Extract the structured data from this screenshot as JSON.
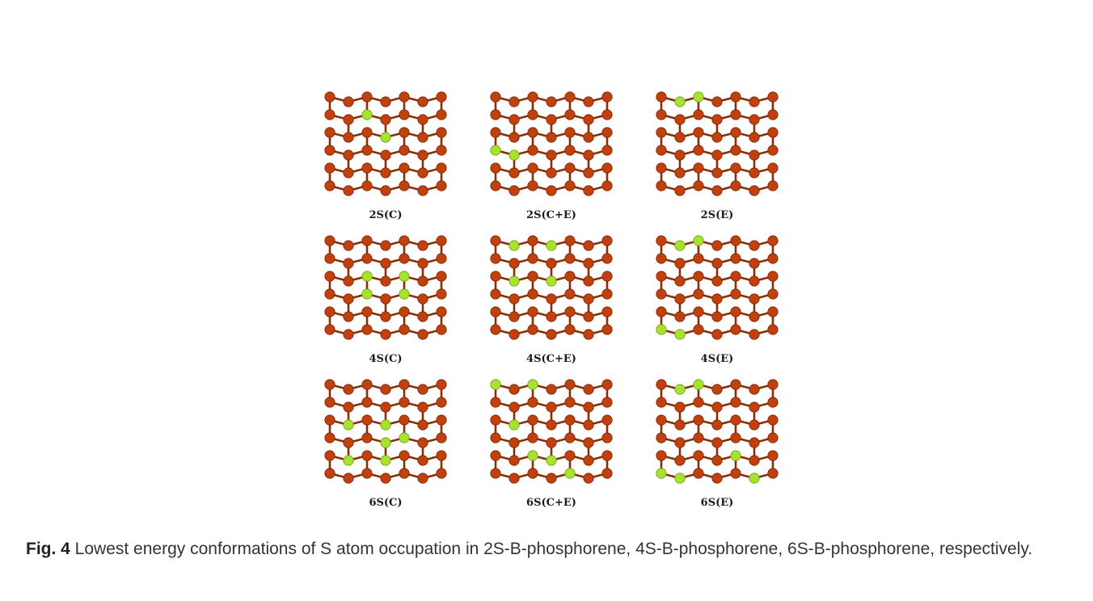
{
  "figure": {
    "panels": [
      {
        "label": "2S(C)",
        "s_sites": [
          [
            1,
            2
          ],
          [
            2,
            3
          ]
        ]
      },
      {
        "label": "2S(C+E)",
        "s_sites": [
          [
            3,
            0
          ],
          [
            3,
            1
          ]
        ]
      },
      {
        "label": "2S(E)",
        "s_sites": [
          [
            0,
            1
          ],
          [
            0,
            2
          ]
        ]
      },
      {
        "label": "4S(C)",
        "s_sites": [
          [
            2,
            2
          ],
          [
            2,
            4
          ],
          [
            3,
            2
          ],
          [
            3,
            4
          ]
        ]
      },
      {
        "label": "4S(C+E)",
        "s_sites": [
          [
            0,
            1
          ],
          [
            0,
            3
          ],
          [
            2,
            1
          ],
          [
            2,
            3
          ]
        ]
      },
      {
        "label": "4S(E)",
        "s_sites": [
          [
            0,
            1
          ],
          [
            0,
            2
          ],
          [
            5,
            0
          ],
          [
            5,
            1
          ]
        ]
      },
      {
        "label": "6S(C)",
        "s_sites": [
          [
            2,
            1
          ],
          [
            2,
            3
          ],
          [
            3,
            3
          ],
          [
            3,
            4
          ],
          [
            4,
            1
          ],
          [
            4,
            3
          ]
        ]
      },
      {
        "label": "6S(C+E)",
        "s_sites": [
          [
            0,
            0
          ],
          [
            0,
            2
          ],
          [
            2,
            1
          ],
          [
            4,
            2
          ],
          [
            4,
            3
          ],
          [
            5,
            4
          ]
        ]
      },
      {
        "label": "6S(E)",
        "s_sites": [
          [
            0,
            1
          ],
          [
            0,
            2
          ],
          [
            5,
            0
          ],
          [
            5,
            1
          ],
          [
            4,
            4
          ],
          [
            5,
            5
          ]
        ]
      }
    ],
    "colors": {
      "phosphorus": "#c0400e",
      "sulfur": "#a6e22e",
      "bond": "#8a2e0a"
    }
  },
  "caption": {
    "label": "Fig. 4",
    "text": " Lowest energy conformations of S atom occupation in 2S-B-phosphorene, 4S-B-phosphorene, 6S-B-phosphorene, respectively."
  }
}
